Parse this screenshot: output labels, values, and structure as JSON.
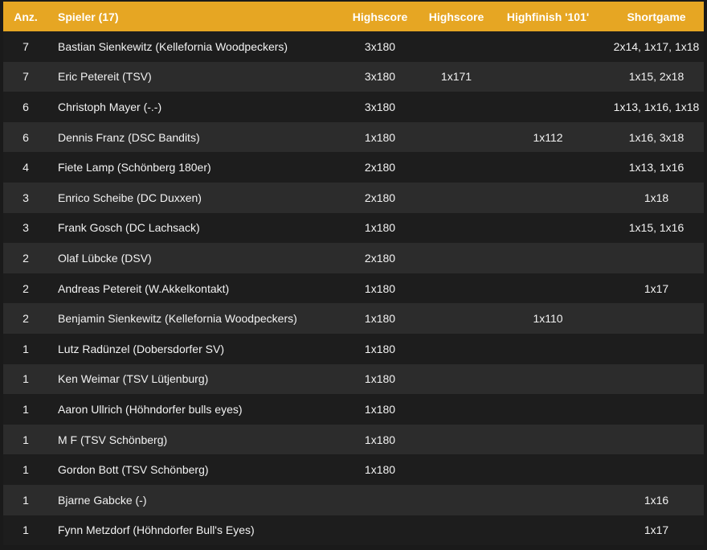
{
  "table": {
    "headers": {
      "anz": "Anz.",
      "player": "Spieler (17)",
      "highscore1": "Highscore",
      "highscore2": "Highscore",
      "highfinish": "Highfinish '101'",
      "shortgame": "Shortgame"
    },
    "rows": [
      {
        "anz": "7",
        "player": "Bastian Sienkewitz (Kellefornia Woodpeckers)",
        "hs1": "3x180",
        "hs2": "",
        "hf": "",
        "sg": "2x14, 1x17, 1x18"
      },
      {
        "anz": "7",
        "player": "Eric Petereit (TSV)",
        "hs1": "3x180",
        "hs2": "1x171",
        "hf": "",
        "sg": "1x15, 2x18"
      },
      {
        "anz": "6",
        "player": "Christoph Mayer (-.-)",
        "hs1": "3x180",
        "hs2": "",
        "hf": "",
        "sg": "1x13, 1x16, 1x18"
      },
      {
        "anz": "6",
        "player": "Dennis Franz (DSC Bandits)",
        "hs1": "1x180",
        "hs2": "",
        "hf": "1x112",
        "sg": "1x16, 3x18"
      },
      {
        "anz": "4",
        "player": "Fiete Lamp (Schönberg 180er)",
        "hs1": "2x180",
        "hs2": "",
        "hf": "",
        "sg": "1x13, 1x16"
      },
      {
        "anz": "3",
        "player": "Enrico Scheibe (DC Duxxen)",
        "hs1": "2x180",
        "hs2": "",
        "hf": "",
        "sg": "1x18"
      },
      {
        "anz": "3",
        "player": "Frank Gosch (DC Lachsack)",
        "hs1": "1x180",
        "hs2": "",
        "hf": "",
        "sg": "1x15, 1x16"
      },
      {
        "anz": "2",
        "player": "Olaf Lübcke (DSV)",
        "hs1": "2x180",
        "hs2": "",
        "hf": "",
        "sg": ""
      },
      {
        "anz": "2",
        "player": "Andreas Petereit (W.Akkelkontakt)",
        "hs1": "1x180",
        "hs2": "",
        "hf": "",
        "sg": "1x17"
      },
      {
        "anz": "2",
        "player": "Benjamin Sienkewitz (Kellefornia Woodpeckers)",
        "hs1": "1x180",
        "hs2": "",
        "hf": "1x110",
        "sg": ""
      },
      {
        "anz": "1",
        "player": "Lutz Radünzel (Dobersdorfer SV)",
        "hs1": "1x180",
        "hs2": "",
        "hf": "",
        "sg": ""
      },
      {
        "anz": "1",
        "player": "Ken Weimar (TSV Lütjenburg)",
        "hs1": "1x180",
        "hs2": "",
        "hf": "",
        "sg": ""
      },
      {
        "anz": "1",
        "player": "Aaron Ullrich (Höhndorfer bulls eyes)",
        "hs1": "1x180",
        "hs2": "",
        "hf": "",
        "sg": ""
      },
      {
        "anz": "1",
        "player": "M F (TSV Schönberg)",
        "hs1": "1x180",
        "hs2": "",
        "hf": "",
        "sg": ""
      },
      {
        "anz": "1",
        "player": "Gordon Bott (TSV Schönberg)",
        "hs1": "1x180",
        "hs2": "",
        "hf": "",
        "sg": ""
      },
      {
        "anz": "1",
        "player": "Bjarne Gabcke (-)",
        "hs1": "",
        "hs2": "",
        "hf": "",
        "sg": "1x16"
      },
      {
        "anz": "1",
        "player": "Fynn Metzdorf (Höhndorfer Bull's Eyes)",
        "hs1": "",
        "hs2": "",
        "hf": "",
        "sg": "1x17"
      }
    ]
  },
  "colors": {
    "header_bg": "#e6a623",
    "row_dark": "#1d1d1d",
    "row_light": "#2c2c2c",
    "text": "#f2f2f2"
  }
}
